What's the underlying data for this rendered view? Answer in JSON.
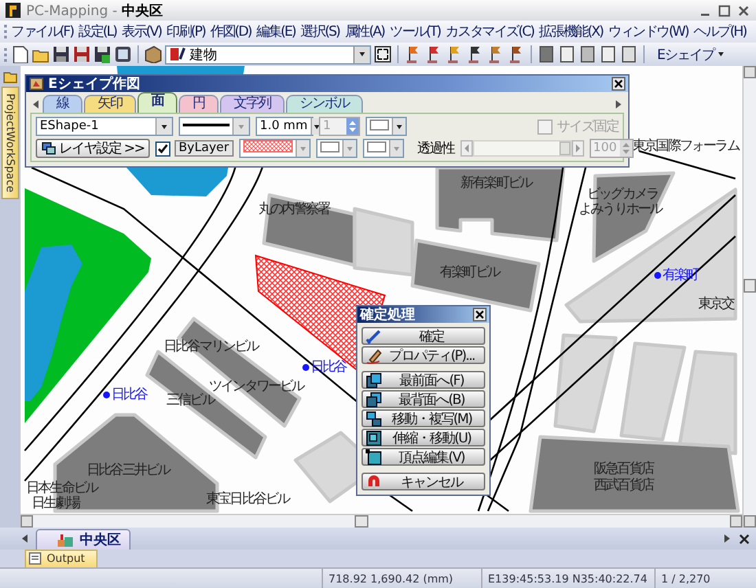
{
  "window": {
    "title": "PC-Mapping - **中央区**"
  },
  "menu": [
    "ファイル(F)",
    "設定(L)",
    "表示(V)",
    "印刷(P)",
    "作図(D)",
    "編集(E)",
    "選択(S)",
    "属性(A)",
    "ツール(T)",
    "カスタマイズ(C)",
    "拡張機能(X)",
    "ウィンドウ(W)",
    "ヘルプ(H)"
  ],
  "toolbar": {
    "layer": "建物",
    "shape_menu": "Eシェイプ"
  },
  "side_tabs": [
    {
      "label": "ProjectWorkSpace",
      "selected": true
    }
  ],
  "map": {
    "labels": [
      {
        "text": "丸の内警察署",
        "kind": "building"
      },
      {
        "text": "新有楽町ビル",
        "kind": "building"
      },
      {
        "text": "ビッグカメラ",
        "kind": "building"
      },
      {
        "text": "よみうりホール",
        "kind": "building"
      },
      {
        "text": "東京国際フォーラム",
        "kind": "building"
      },
      {
        "text": "有楽町ビル",
        "kind": "building"
      },
      {
        "text": "有楽町",
        "kind": "station"
      },
      {
        "text": "東京交",
        "kind": "building"
      },
      {
        "text": "日比谷マリンビル",
        "kind": "building"
      },
      {
        "text": "ツインタワービル",
        "kind": "building"
      },
      {
        "text": "三信ビル",
        "kind": "building"
      },
      {
        "text": "日比谷",
        "kind": "station"
      },
      {
        "text": "日比谷",
        "kind": "station"
      },
      {
        "text": "日比谷三井ビル",
        "kind": "building"
      },
      {
        "text": "日本生命ビル",
        "kind": "building"
      },
      {
        "text": "日生劇場",
        "kind": "building"
      },
      {
        "text": "東宝日比谷ビル",
        "kind": "building"
      },
      {
        "text": "阪急百貨店",
        "kind": "building"
      },
      {
        "text": "西武百貨店",
        "kind": "building"
      }
    ]
  },
  "eshape_panel": {
    "title": "Eシェイプ作図",
    "tabs": [
      {
        "label": "線",
        "color": "#b8cff0",
        "selected": false
      },
      {
        "label": "矢印",
        "color": "#f6dc80",
        "selected": false
      },
      {
        "label": "面",
        "color": "#dcefc8",
        "selected": true
      },
      {
        "label": "円",
        "color": "#f4c2cc",
        "selected": false
      },
      {
        "label": "文字列",
        "color": "#d4c4f0",
        "selected": false
      },
      {
        "label": "シンボル",
        "color": "#c4e4e0",
        "selected": false
      }
    ],
    "shape_name": "EShape-1",
    "line_width": "1.0 mm",
    "count": {
      "value": "1",
      "disabled": true
    },
    "size_fixed": {
      "label": "サイズ固定",
      "checked": false,
      "disabled": true
    },
    "layer_button": "レイヤ設定 >>",
    "by_layer": {
      "label": "ByLayer",
      "checked": true
    },
    "transparency": {
      "label": "透過性",
      "level": 1,
      "value": "100",
      "disabled": true
    }
  },
  "confirm_panel": {
    "title": "確定処理",
    "groups": [
      [
        "確定",
        "プロパティ(P)..."
      ],
      [
        "最前面へ(F)",
        "最背面へ(B)",
        "移動・複写(M)",
        "伸縮・移動(U)",
        "頂点編集(V)"
      ],
      [
        "キャンセル"
      ]
    ]
  },
  "document_tabs": [
    {
      "label": "中央区",
      "selected": true
    }
  ],
  "output_tabs": [
    {
      "label": "Output",
      "selected": true
    }
  ],
  "status_bar": [
    "718.92 1,690.42 (mm)",
    "E139:45:53.19 N35:40:22.74",
    "1 / 2,270"
  ]
}
